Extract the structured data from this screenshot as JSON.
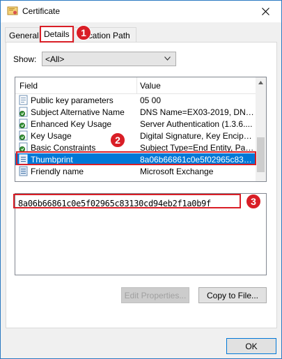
{
  "window": {
    "title": "Certificate",
    "close_icon": "close-icon"
  },
  "tabs": [
    {
      "label": "General",
      "active": false
    },
    {
      "label": "Details",
      "active": true
    },
    {
      "label": "ication Path",
      "active": false
    }
  ],
  "show": {
    "label": "Show:",
    "selected": "<All>"
  },
  "list": {
    "columns": {
      "field": "Field",
      "value": "Value"
    },
    "rows": [
      {
        "icon": "certificate-field-icon",
        "field": "Public key parameters",
        "value": "05 00",
        "selected": false
      },
      {
        "icon": "certificate-extension-icon",
        "field": "Subject Alternative Name",
        "value": "DNS Name=EX03-2019, DNS N...",
        "selected": false
      },
      {
        "icon": "certificate-extension-icon",
        "field": "Enhanced Key Usage",
        "value": "Server Authentication (1.3.6....",
        "selected": false
      },
      {
        "icon": "certificate-extension-icon",
        "field": "Key Usage",
        "value": "Digital Signature, Key Encipher...",
        "selected": false
      },
      {
        "icon": "certificate-extension-icon",
        "field": "Basic Constraints",
        "value": "Subject Type=End Entity, Pat...",
        "selected": false
      },
      {
        "icon": "certificate-property-icon",
        "field": "Thumbprint",
        "value": "8a06b66861c0e5f02965c8313...",
        "selected": true
      },
      {
        "icon": "certificate-property-icon",
        "field": "Friendly name",
        "value": "Microsoft Exchange",
        "selected": false
      }
    ]
  },
  "detail": {
    "value": "8a06b66861c0e5f02965c83130cd94eb2f1a0b9f"
  },
  "buttons": {
    "edit_properties": "Edit Properties...",
    "copy_to_file": "Copy to File...",
    "ok": "OK"
  },
  "markers": [
    "1",
    "2",
    "3"
  ],
  "colors": {
    "accent": "#0078d7",
    "highlight": "#d91e26"
  }
}
